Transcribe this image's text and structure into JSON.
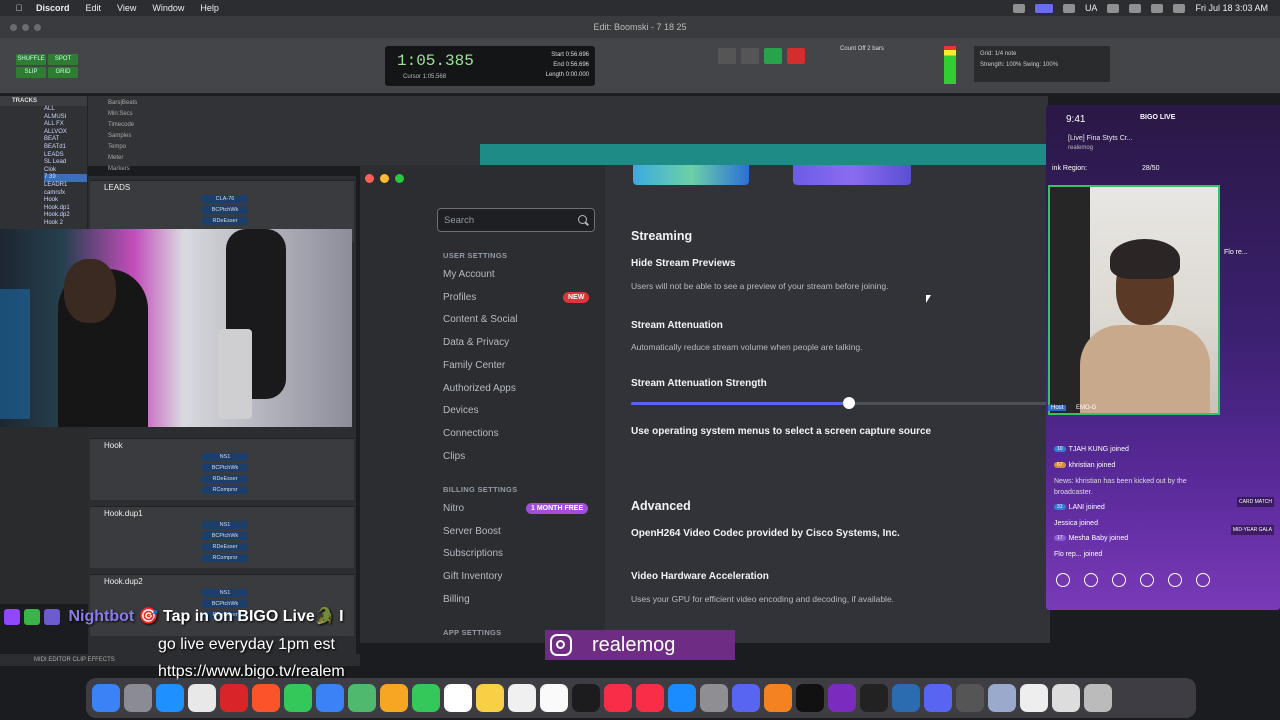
{
  "menubar": {
    "app": "Discord",
    "items": [
      "Edit",
      "View",
      "Window",
      "Help"
    ],
    "lang": "UA",
    "datetime": "Fri Jul 18  3:03 AM"
  },
  "protools": {
    "window_title": "Edit: Boomski - 7 18 25",
    "modes": [
      "SHUFFLE",
      "SPOT",
      "SLIP",
      "GRID"
    ],
    "counter_main": "1:05.385",
    "counter_cursor_label": "Cursor",
    "counter_cursor": "1:05.568",
    "range": [
      "Start 0:56.696",
      "End 0:56.696",
      "Length 0:00.000"
    ],
    "grid": "Grid:",
    "grid_value": "1/4 note",
    "strength": "Strength:  100%   Swing:  100%",
    "count_off": "Count Off  2 bars",
    "tracks_header": "TRACKS",
    "tracks": [
      "ALL",
      "ALMUSI",
      "ALL FX",
      "ALLVOX",
      "BEAT",
      "BEATd1",
      "LEADS",
      "SL Lead",
      "Clok",
      "7 39",
      "LEADR1",
      "camrsfx",
      "Hook",
      "Hook.dp1",
      "Hook.dp2",
      "Hook 2"
    ],
    "ruler_rows": [
      "Bars|Beats",
      "Min:Secs",
      "Timecode",
      "Samples",
      "Tempo",
      "Meter",
      "Markers"
    ],
    "strips": [
      {
        "name": "LEADS",
        "fx": [
          "CLA-76",
          "BCPtchWk",
          "RDeEsser"
        ]
      },
      {
        "name": "Hook",
        "fx": [
          "NS1",
          "BCPtchWk",
          "RDeEsser",
          "RComprsr"
        ]
      },
      {
        "name": "Hook.dup1",
        "fx": [
          "NS1",
          "BCPtchWk",
          "RDeEsser",
          "RComprsr"
        ]
      },
      {
        "name": "Hook.dup2",
        "fx": [
          "NS1",
          "BCPtchWk",
          "RDeEsser"
        ]
      }
    ],
    "bottom_tabs": "MIDI EDITOR    CLIP EFFECTS"
  },
  "discord": {
    "search_placeholder": "Search",
    "user_settings_header": "USER SETTINGS",
    "user_settings": [
      "My Account",
      "Profiles",
      "Content & Social",
      "Data & Privacy",
      "Family Center",
      "Authorized Apps",
      "Devices",
      "Connections",
      "Clips"
    ],
    "profiles_badge": "NEW",
    "billing_header": "BILLING SETTINGS",
    "billing": [
      "Nitro",
      "Server Boost",
      "Subscriptions",
      "Gift Inventory",
      "Billing"
    ],
    "nitro_badge": "1 MONTH FREE",
    "app_settings_header": "APP SETTINGS",
    "streaming_title": "Streaming",
    "hide_previews_title": "Hide Stream Previews",
    "hide_previews_desc": "Users will not be able to see a preview of your stream before joining.",
    "attenuation_title": "Stream Attenuation",
    "attenuation_desc": "Automatically reduce stream volume when people are talking.",
    "attenuation_strength_title": "Stream Attenuation Strength",
    "attenuation_strength_value": 0.52,
    "os_menus_title": "Use operating system menus to select a screen capture source",
    "advanced_title": "Advanced",
    "openh264_title": "OpenH264 Video Codec provided by Cisco Systems, Inc.",
    "hw_accel_title": "Video Hardware Acceleration",
    "hw_accel_desc": "Uses your GPU for efficient video encoding and decoding, if available."
  },
  "bigo": {
    "time": "9:41",
    "brand": "BIGO LIVE",
    "host_line": "[Live] Fina Styts Cr...",
    "sub_line": "realemog",
    "region": "ink   Region:",
    "count": "28/50",
    "side_label": "Flo re...",
    "host_tag": "Host",
    "host_name": "EMO-G",
    "chat": [
      {
        "lvl": "10",
        "text": "TJAH KUNG joined"
      },
      {
        "lvl": "67",
        "text": "khristian joined"
      }
    ],
    "news": "News: khristian has been kicked out by the broadcaster.",
    "chat2": [
      {
        "lvl": "31",
        "text": "LANI joined"
      },
      {
        "lvl": "",
        "text": "Jessica joined"
      },
      {
        "lvl": "17",
        "text": "Mesha Baby joined"
      },
      {
        "lvl": "",
        "text": "Flo rep... joined"
      }
    ],
    "card_match": "CARD MATCH",
    "mid_year": "MID-YEAR GALA"
  },
  "overlay": {
    "nightbot_name": "Nightbot",
    "nightbot_msg": "🎯 Tap in on BIGO Live🐊 I",
    "line2": "go live everyday 1pm est",
    "line3": "https://www.bigo.tv/realem",
    "instagram": "realemog"
  },
  "dock": [
    "Finder",
    "Launchpad",
    "Safari",
    "Chrome",
    "Opera",
    "Brave",
    "Messages",
    "Mail",
    "Maps",
    "Photos",
    "FaceTime",
    "Calendar 18",
    "Notes",
    "Reminders",
    "Freeform",
    "TV",
    "Music",
    "News",
    "App Store",
    "Settings",
    "Discord",
    "FL",
    "Live",
    "Logic",
    "Pro Tools",
    "Lightroom",
    "Discord",
    "Calculator",
    "Finder2",
    "Notes2",
    "Audio",
    "Trash"
  ]
}
